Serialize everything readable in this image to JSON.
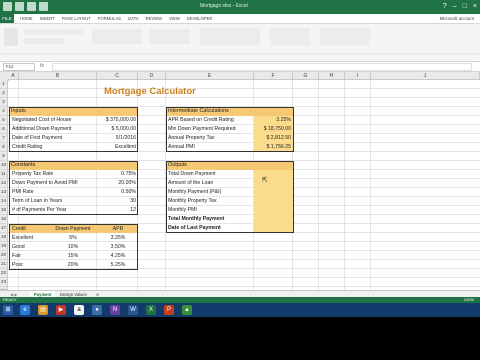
{
  "window": {
    "title": "Mortgage.xlsx - Excel"
  },
  "menu": {
    "file": "FILE",
    "tabs": [
      "HOME",
      "INSERT",
      "PAGE LAYOUT",
      "FORMULAS",
      "DATA",
      "REVIEW",
      "VIEW",
      "DEVELOPER"
    ],
    "signin": "Microsoft account"
  },
  "formula_bar": {
    "name_box": "F12",
    "fx": "fx"
  },
  "columns": [
    "A",
    "B",
    "C",
    "D",
    "E",
    "F",
    "G",
    "H",
    "I",
    "J"
  ],
  "rows": [
    "1",
    "2",
    "3",
    "4",
    "5",
    "6",
    "7",
    "8",
    "9",
    "10",
    "11",
    "12",
    "13",
    "14",
    "15",
    "16",
    "17",
    "18",
    "19",
    "20",
    "21",
    "22",
    "23",
    "24"
  ],
  "title": "Mortgage Calculator",
  "inputs": {
    "header": "Inputs",
    "rows": [
      {
        "label": "Negotiated Cost of House",
        "value": "$ 375,000.00"
      },
      {
        "label": "Additional Down  Payment",
        "value": "$    5,000.00"
      },
      {
        "label": "Date of First Payment",
        "value": "5/1/2016"
      },
      {
        "label": "Credit Rating",
        "value": "Excellent"
      }
    ]
  },
  "constants": {
    "header": "Constants",
    "rows": [
      {
        "label": "Property Tax Rate",
        "value": "0.75%"
      },
      {
        "label": "Down Payment to Avoid PMI",
        "value": "20.00%"
      },
      {
        "label": "PMI Rate",
        "value": "0.50%"
      },
      {
        "label": "Term of Loan in Years",
        "value": "30"
      },
      {
        "label": "# of Payments Per Year",
        "value": "12"
      }
    ]
  },
  "credit_table": {
    "headers": [
      "Credit",
      "Down Payment",
      "APR"
    ],
    "rows": [
      [
        "Excellent",
        "5%",
        "3.25%"
      ],
      [
        "Good",
        "10%",
        "3.50%"
      ],
      [
        "Fair",
        "15%",
        "4.25%"
      ],
      [
        "Poor",
        "20%",
        "5.25%"
      ]
    ]
  },
  "intermediate": {
    "header": "Intermediate Calculations",
    "rows": [
      {
        "label": "APR Based on Credit Rating",
        "value": "3.25%"
      },
      {
        "label": "Min Down Payment Required",
        "value": "$   18,750.00"
      },
      {
        "label": "Annual Property Tax",
        "value": "$    2,812.50"
      },
      {
        "label": "Annual PMI",
        "value": "$    1,756.25"
      }
    ]
  },
  "outputs": {
    "header": "Outputs",
    "rows": [
      {
        "label": "Total Down Payment",
        "bold": false
      },
      {
        "label": "Amount of the Loan",
        "bold": false
      },
      {
        "label": "Monthly Payment (P&I)",
        "bold": false
      },
      {
        "label": "Monthly Property Tax",
        "bold": false
      },
      {
        "label": "Monthly PMI",
        "bold": false
      },
      {
        "label": "Total Monthly Payment",
        "bold": true
      },
      {
        "label": "Date of Last Payment",
        "bold": true
      }
    ]
  },
  "sheets": [
    "Payment",
    "Design Values"
  ],
  "status": {
    "ready": "READY",
    "zoom": "100%"
  },
  "colors": {
    "excel_green": "#217346",
    "header_fill": "#f7c873",
    "output_fill": "#fbdb8c",
    "title": "#c8801a"
  }
}
